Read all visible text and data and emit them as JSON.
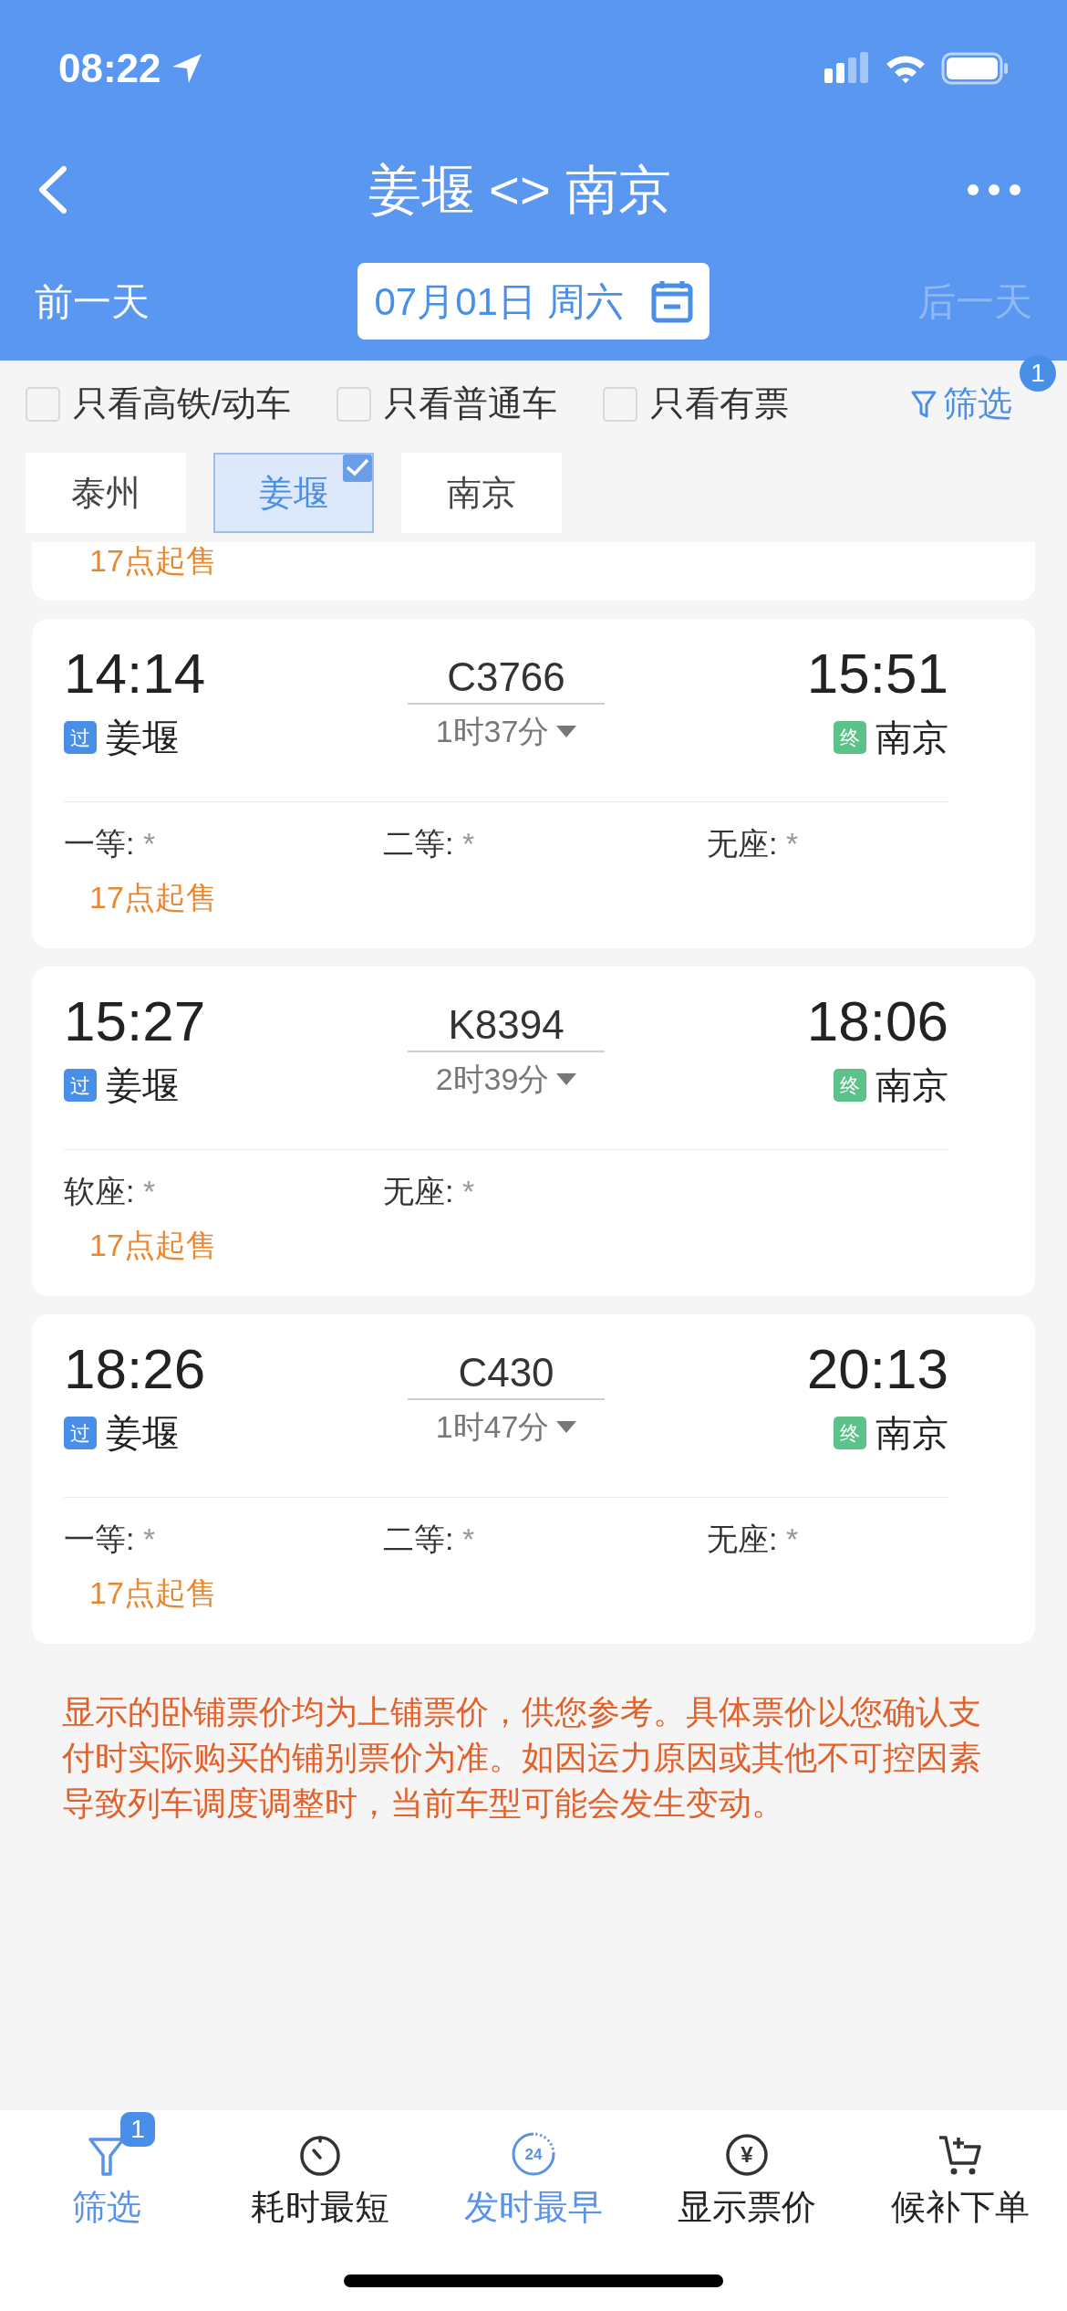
{
  "status_bar": {
    "time": "08:22"
  },
  "nav": {
    "title": "姜堰 <> 南京"
  },
  "date_bar": {
    "prev": "前一天",
    "date": "07月01日 周六",
    "next": "后一天",
    "next_disabled": true
  },
  "filters": [
    {
      "label": "只看高铁/动车",
      "checked": false
    },
    {
      "label": "只看普通车",
      "checked": false
    },
    {
      "label": "只看有票",
      "checked": false
    }
  ],
  "filter_button": {
    "label": "筛选",
    "badge": "1"
  },
  "stations": [
    {
      "label": "泰州",
      "selected": false
    },
    {
      "label": "姜堰",
      "selected": true
    },
    {
      "label": "南京",
      "selected": false
    }
  ],
  "partial_card": {
    "sale_note": "17点起售"
  },
  "trains": [
    {
      "depart_time": "14:14",
      "from_tag": {
        "text": "过",
        "color": "#4a8fe7"
      },
      "from": "姜堰",
      "number": "C3766",
      "duration": "1时37分",
      "arrive_time": "15:51",
      "to_tag": {
        "text": "终",
        "color": "#5cc28a"
      },
      "to": "南京",
      "seats": [
        {
          "label": "一等:",
          "value": "*"
        },
        {
          "label": "二等:",
          "value": "*"
        },
        {
          "label": "无座:",
          "value": "*"
        }
      ],
      "sale_note": "17点起售"
    },
    {
      "depart_time": "15:27",
      "from_tag": {
        "text": "过",
        "color": "#4a8fe7"
      },
      "from": "姜堰",
      "number": "K8394",
      "duration": "2时39分",
      "arrive_time": "18:06",
      "to_tag": {
        "text": "终",
        "color": "#5cc28a"
      },
      "to": "南京",
      "seats": [
        {
          "label": "软座:",
          "value": "*"
        },
        {
          "label": "无座:",
          "value": "*"
        }
      ],
      "sale_note": "17点起售"
    },
    {
      "depart_time": "18:26",
      "from_tag": {
        "text": "过",
        "color": "#4a8fe7"
      },
      "from": "姜堰",
      "number": "C430",
      "duration": "1时47分",
      "arrive_time": "20:13",
      "to_tag": {
        "text": "终",
        "color": "#5cc28a"
      },
      "to": "南京",
      "seats": [
        {
          "label": "一等:",
          "value": "*"
        },
        {
          "label": "二等:",
          "value": "*"
        },
        {
          "label": "无座:",
          "value": "*"
        }
      ],
      "sale_note": "17点起售"
    }
  ],
  "notice": "显示的卧铺票价均为上铺票价，供您参考。具体票价以您确认支付时实际购买的铺别票价为准。如因运力原因或其他不可控因素导致列车调度调整时，当前车型可能会发生变动。",
  "bottom_tabs": [
    {
      "label": "筛选",
      "kind": "filter",
      "selected": true,
      "badge": "1"
    },
    {
      "label": "耗时最短",
      "kind": "timer",
      "selected": false
    },
    {
      "label": "发时最早",
      "kind": "clock24",
      "icon_text": "24",
      "selected": true
    },
    {
      "label": "显示票价",
      "kind": "yen",
      "icon_text": "¥",
      "selected": false
    },
    {
      "label": "候补下单",
      "kind": "cart",
      "selected": false
    }
  ]
}
